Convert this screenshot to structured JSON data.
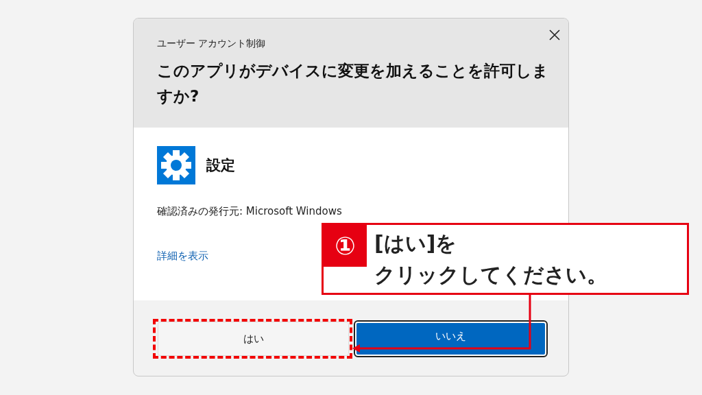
{
  "dialog": {
    "title": "ユーザー アカウント制御",
    "question": "このアプリがデバイスに変更を加えることを許可しますか?",
    "app_name": "設定",
    "publisher": "確認済みの発行元: Microsoft Windows",
    "details_link": "詳細を表示",
    "buttons": [
      {
        "label": "はい",
        "kind": "secondary",
        "highlighted": true
      },
      {
        "label": "いいえ",
        "kind": "primary",
        "highlighted": false
      }
    ]
  },
  "callout": {
    "number": "①",
    "lines": [
      "[はい]を",
      "クリックしてください。"
    ]
  }
}
